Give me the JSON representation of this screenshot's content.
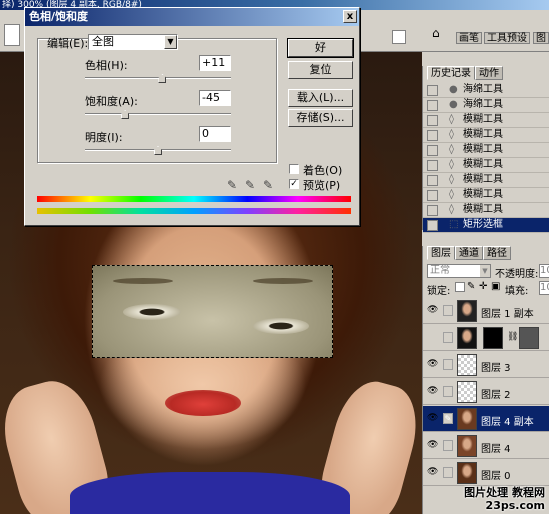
{
  "window": {
    "title": "择)    300% (图层 4 副本, RGB/8#)"
  },
  "dialog": {
    "title": "色相/饱和度",
    "close": "x",
    "edit_label": "编辑(E):",
    "edit_value": "全图",
    "hue_label": "色相(H):",
    "hue_value": "+11",
    "hue_level": 11,
    "sat_label": "饱和度(A):",
    "sat_value": "-45",
    "sat_level": -45,
    "light_label": "明度(I):",
    "light_value": "0",
    "light_level": 0,
    "ok": "好",
    "reset": "复位",
    "load": "载入(L)...",
    "save": "存储(S)...",
    "colorize_label": "着色(O)",
    "colorize_checked": false,
    "preview_label": "预览(P)",
    "preview_checked": true,
    "preview_mark": "✓"
  },
  "options_bar": {
    "dock_tab_1": "画笔",
    "dock_tab_2": "工具预设",
    "dock_tab_3": "图"
  },
  "history": {
    "tab_active": "历史记录",
    "tab_inactive": "动作",
    "items": [
      {
        "label": "海绵工具",
        "icon": "sponge-icon"
      },
      {
        "label": "海绵工具",
        "icon": "sponge-icon"
      },
      {
        "label": "模糊工具",
        "icon": "blur-drop-icon"
      },
      {
        "label": "模糊工具",
        "icon": "blur-drop-icon"
      },
      {
        "label": "模糊工具",
        "icon": "blur-drop-icon"
      },
      {
        "label": "模糊工具",
        "icon": "blur-drop-icon"
      },
      {
        "label": "模糊工具",
        "icon": "blur-drop-icon"
      },
      {
        "label": "模糊工具",
        "icon": "blur-drop-icon"
      },
      {
        "label": "模糊工具",
        "icon": "blur-drop-icon"
      },
      {
        "label": "矩形选框",
        "icon": "marquee-icon"
      }
    ]
  },
  "layers": {
    "tab_1": "图层",
    "tab_2": "通道",
    "tab_3": "路径",
    "blend_mode": "正常",
    "opacity_label": "不透明度:",
    "opacity_value": "10",
    "lock_label": "锁定:",
    "fill_label": "填充:",
    "fill_value": "10",
    "rows": [
      {
        "name": "图层 1 副本"
      },
      {
        "name": ""
      },
      {
        "name": "图层 3"
      },
      {
        "name": "图层 2"
      },
      {
        "name": "图层 4 副本"
      },
      {
        "name": "图层 4"
      },
      {
        "name": "图层 0"
      }
    ]
  },
  "watermark": {
    "line1": "图片处理  教程网",
    "line2": "23ps.com"
  }
}
